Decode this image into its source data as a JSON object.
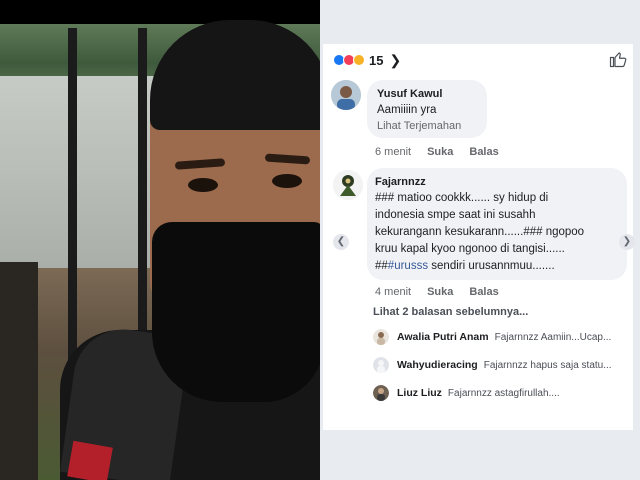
{
  "post": {
    "reaction_count": "15",
    "reaction_colors": [
      "#1877f2",
      "#f33e58",
      "#f7b125"
    ]
  },
  "comments": [
    {
      "name": "Yusuf Kawul",
      "text": "Aamiiiin yra",
      "translate": "Lihat Terjemahan",
      "time": "6 menit",
      "like": "Suka",
      "reply": "Balas"
    },
    {
      "name": "Fajarnnzz",
      "line1": "### matioo cookkk...... sy hidup di",
      "line2": "indonesia smpe saat ini susahh",
      "line3": "kekurangann kesukarann......### ngopoo",
      "line4": "kruu kapal kyoo ngonoo di tangisi......",
      "line5_prefix": "##",
      "line5_link": "#urusss",
      "line5_suffix": " sendiri urusannmuu.......",
      "time": "4 menit",
      "like": "Suka",
      "reply": "Balas"
    }
  ],
  "replies": {
    "previous": "Lihat 2 balasan sebelumnya...",
    "items": [
      {
        "name": "Awalia Putri Anam",
        "text": "Fajarnnzz Aamiin...Ucap..."
      },
      {
        "name": "Wahyudieracing",
        "text": "Fajarnnzz hapus saja statu..."
      },
      {
        "name": "Liuz Liuz",
        "text": "Fajarnnzz astagfirullah...."
      }
    ]
  }
}
